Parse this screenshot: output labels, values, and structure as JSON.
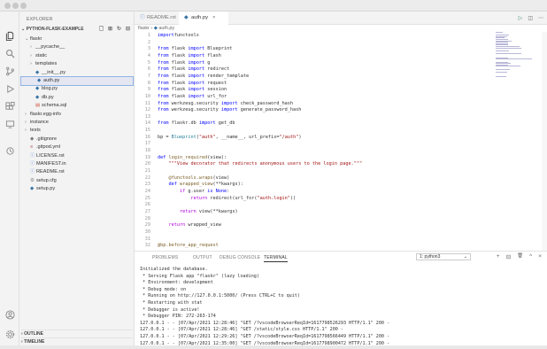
{
  "window": {
    "dots": [
      "close",
      "minimize",
      "maximize"
    ]
  },
  "activity_bar": {
    "items": [
      "files-icon",
      "search-icon",
      "source-control-icon",
      "run-debug-icon",
      "extensions-icon",
      "remote-icon",
      "account-icon",
      "settings-icon"
    ]
  },
  "sidebar": {
    "title": "EXPLORER",
    "project": "PYTHON-FLASK-EXAMPLE",
    "tree": [
      {
        "label": "flaskr",
        "indent": 1,
        "chev": "⌄",
        "icon": ""
      },
      {
        "label": "__pycache__",
        "indent": 2,
        "chev": "›",
        "icon": ""
      },
      {
        "label": "static",
        "indent": 2,
        "chev": "›",
        "icon": ""
      },
      {
        "label": "templates",
        "indent": 2,
        "chev": "›",
        "icon": ""
      },
      {
        "label": "__init__.py",
        "indent": 2,
        "chev": "",
        "icon": "py"
      },
      {
        "label": "auth.py",
        "indent": 2,
        "chev": "",
        "icon": "py",
        "selected": true
      },
      {
        "label": "blog.py",
        "indent": 2,
        "chev": "",
        "icon": "py"
      },
      {
        "label": "db.py",
        "indent": 2,
        "chev": "",
        "icon": "py"
      },
      {
        "label": "schema.sql",
        "indent": 2,
        "chev": "",
        "icon": "sql"
      },
      {
        "label": "flaskr.egg-info",
        "indent": 1,
        "chev": "›",
        "icon": ""
      },
      {
        "label": "instance",
        "indent": 1,
        "chev": "›",
        "icon": ""
      },
      {
        "label": "tests",
        "indent": 1,
        "chev": "›",
        "icon": ""
      },
      {
        "label": ".gitignore",
        "indent": 1,
        "chev": "",
        "icon": "git"
      },
      {
        "label": ".gitpod.yml",
        "indent": 1,
        "chev": "",
        "icon": "yml"
      },
      {
        "label": "LICENSE.rst",
        "indent": 1,
        "chev": "",
        "icon": "txt"
      },
      {
        "label": "MANIFEST.in",
        "indent": 1,
        "chev": "",
        "icon": "txt"
      },
      {
        "label": "README.rst",
        "indent": 1,
        "chev": "",
        "icon": "txt"
      },
      {
        "label": "setup.cfg",
        "indent": 1,
        "chev": "",
        "icon": "cfg"
      },
      {
        "label": "setup.py",
        "indent": 1,
        "chev": "",
        "icon": "py"
      }
    ],
    "outline": "OUTLINE",
    "timeline": "TIMELINE"
  },
  "tabs": [
    {
      "label": "README.rst",
      "active": false
    },
    {
      "label": "auth.py",
      "active": true
    }
  ],
  "breadcrumb": {
    "folder": "flaskr",
    "sep": "›",
    "file": "auth.py"
  },
  "editor": {
    "lines": [
      {
        "n": "1",
        "code": [
          [
            "kw",
            "import"
          ],
          [
            "",
            "functools"
          ]
        ]
      },
      {
        "n": "2",
        "code": []
      },
      {
        "n": "3",
        "code": [
          [
            "kw",
            "from"
          ],
          [
            "",
            " flask "
          ],
          [
            "kw",
            "import"
          ],
          [
            "",
            " Blueprint"
          ]
        ]
      },
      {
        "n": "4",
        "code": [
          [
            "kw",
            "from"
          ],
          [
            "",
            " flask "
          ],
          [
            "kw",
            "import"
          ],
          [
            "",
            " flash"
          ]
        ]
      },
      {
        "n": "5",
        "code": [
          [
            "kw",
            "from"
          ],
          [
            "",
            " flask "
          ],
          [
            "kw",
            "import"
          ],
          [
            "",
            " g"
          ]
        ]
      },
      {
        "n": "6",
        "code": [
          [
            "kw",
            "from"
          ],
          [
            "",
            " flask "
          ],
          [
            "kw",
            "import"
          ],
          [
            "",
            " redirect"
          ]
        ]
      },
      {
        "n": "7",
        "code": [
          [
            "kw",
            "from"
          ],
          [
            "",
            " flask "
          ],
          [
            "kw",
            "import"
          ],
          [
            "",
            " render_template"
          ]
        ]
      },
      {
        "n": "8",
        "code": [
          [
            "kw",
            "from"
          ],
          [
            "",
            " flask "
          ],
          [
            "kw",
            "import"
          ],
          [
            "",
            " request"
          ]
        ]
      },
      {
        "n": "9",
        "code": [
          [
            "kw",
            "from"
          ],
          [
            "",
            " flask "
          ],
          [
            "kw",
            "import"
          ],
          [
            "",
            " session"
          ]
        ]
      },
      {
        "n": "10",
        "code": [
          [
            "kw",
            "from"
          ],
          [
            "",
            " flask "
          ],
          [
            "kw",
            "import"
          ],
          [
            "",
            " url_for"
          ]
        ]
      },
      {
        "n": "11",
        "code": [
          [
            "kw",
            "from"
          ],
          [
            "",
            " werkzeug.security "
          ],
          [
            "kw",
            "import"
          ],
          [
            "",
            " check_password_hash"
          ]
        ]
      },
      {
        "n": "12",
        "code": [
          [
            "kw",
            "from"
          ],
          [
            "",
            " werkzeug.security "
          ],
          [
            "kw",
            "import"
          ],
          [
            "",
            " generate_password_hash"
          ]
        ]
      },
      {
        "n": "13",
        "code": []
      },
      {
        "n": "14",
        "code": [
          [
            "kw",
            "from"
          ],
          [
            "",
            " flaskr.db "
          ],
          [
            "kw",
            "import"
          ],
          [
            "",
            " get_db"
          ]
        ]
      },
      {
        "n": "15",
        "code": []
      },
      {
        "n": "16",
        "code": [
          [
            "",
            "bp = "
          ],
          [
            "cl",
            "Blueprint"
          ],
          [
            "",
            "("
          ],
          [
            "st",
            "\"auth\""
          ],
          [
            "",
            ", "
          ],
          [
            "",
            "__name__"
          ],
          [
            "",
            ", url_prefix="
          ],
          [
            "st",
            "\"/auth\""
          ],
          [
            "",
            ")"
          ]
        ]
      },
      {
        "n": "17",
        "code": []
      },
      {
        "n": "18",
        "code": []
      },
      {
        "n": "19",
        "code": [
          [
            "kw",
            "def"
          ],
          [
            "",
            " "
          ],
          [
            "fn",
            "login_required"
          ],
          [
            "",
            "(view):"
          ]
        ]
      },
      {
        "n": "20",
        "code": [
          [
            "",
            "    "
          ],
          [
            "st",
            "\"\"\"View decorator that redirects anonymous users to the login page.\"\"\""
          ]
        ]
      },
      {
        "n": "21",
        "code": []
      },
      {
        "n": "22",
        "code": [
          [
            "",
            "    "
          ],
          [
            "de",
            "@functools.wraps"
          ],
          [
            "",
            "(view)"
          ]
        ]
      },
      {
        "n": "23",
        "code": [
          [
            "",
            "    "
          ],
          [
            "kw",
            "def"
          ],
          [
            "",
            " "
          ],
          [
            "fn",
            "wrapped_view"
          ],
          [
            "",
            "(**kwargs):"
          ]
        ]
      },
      {
        "n": "24",
        "code": [
          [
            "",
            "        "
          ],
          [
            "kw2",
            "if"
          ],
          [
            "",
            " g.user "
          ],
          [
            "kw",
            "is"
          ],
          [
            "",
            " "
          ],
          [
            "kw",
            "None"
          ],
          [
            "",
            ":"
          ]
        ]
      },
      {
        "n": "25",
        "code": [
          [
            "",
            "            "
          ],
          [
            "kw2",
            "return"
          ],
          [
            "",
            " redirect(url_for("
          ],
          [
            "st",
            "\"auth.login\""
          ],
          [
            "",
            "))"
          ]
        ]
      },
      {
        "n": "26",
        "code": []
      },
      {
        "n": "27",
        "code": [
          [
            "",
            "        "
          ],
          [
            "kw2",
            "return"
          ],
          [
            "",
            " view(**kwargs)"
          ]
        ]
      },
      {
        "n": "28",
        "code": []
      },
      {
        "n": "29",
        "code": [
          [
            "",
            "    "
          ],
          [
            "kw2",
            "return"
          ],
          [
            "",
            " wrapped_view"
          ]
        ]
      },
      {
        "n": "30",
        "code": []
      },
      {
        "n": "31",
        "code": []
      },
      {
        "n": "32",
        "code": [
          [
            "de",
            "@bp.before_app_request"
          ]
        ]
      }
    ]
  },
  "panel": {
    "tabs": [
      "PROBLEMS",
      "OUTPUT",
      "DEBUG CONSOLE",
      "TERMINAL"
    ],
    "active_tab": "TERMINAL",
    "terminal_select": "1: python3",
    "actions": [
      "+",
      "⊟",
      "🗑",
      "^",
      "×"
    ],
    "terminal_lines": [
      "Initialized the database.",
      " * Serving Flask app \"flaskr\" (lazy loading)",
      " * Environment: development",
      " * Debug mode: on",
      " * Running on http://127.0.0.1:5000/ (Press CTRL+C to quit)",
      " * Restarting with stat",
      " * Debugger is active!",
      " * Debugger PIN: 272-263-174",
      "127.0.0.1 - - [07/Apr/2021 12:28:46] \"GET /?vscodeBrowserReqId=1617798526293 HTTP/1.1\" 200 -",
      "127.0.0.1 - - [07/Apr/2021 12:28:46] \"GET /static/style.css HTTP/1.1\" 200 -",
      "127.0.0.1 - - [07/Apr/2021 12:29:26] \"GET /?vscodeBrowserReqId=1617798566449 HTTP/1.1\" 200 -",
      "127.0.0.1 - - [07/Apr/2021 12:35:00] \"GET /?vscodeBrowserReqId=1617798900472 HTTP/1.1\" 200 -"
    ]
  }
}
